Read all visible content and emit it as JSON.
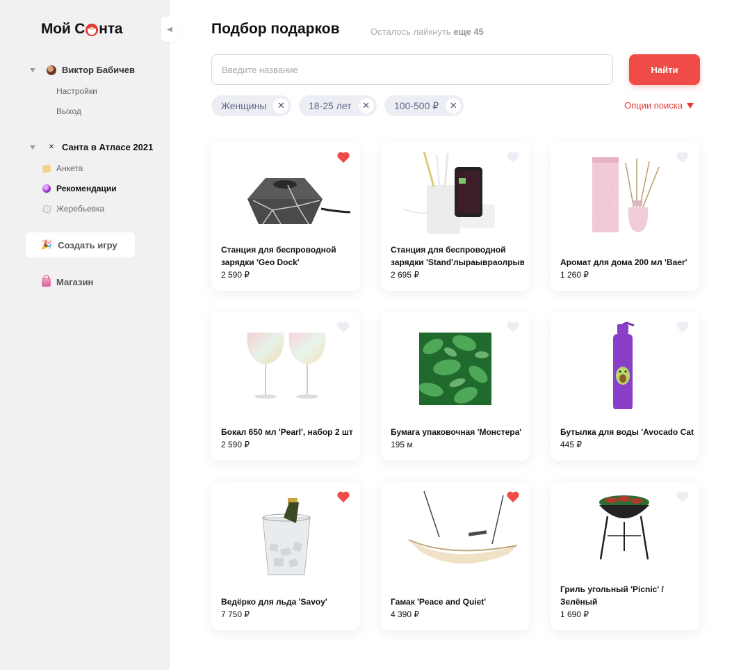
{
  "app": {
    "logo_before": "Мой С",
    "logo_after": "нта"
  },
  "sidebar": {
    "user": {
      "name": "Виктор Бабичев",
      "links": [
        "Настройки",
        "Выход"
      ]
    },
    "game": {
      "name": "Санта в Атласе 2021",
      "icon_text": "✕",
      "items": [
        {
          "label": "Анкета",
          "icon": "notepad-icon",
          "active": false
        },
        {
          "label": "Рекомендации",
          "icon": "crystal-ball-icon",
          "active": true
        },
        {
          "label": "Жеребьевка",
          "icon": "dice-icon",
          "active": false
        }
      ]
    },
    "create_game": "Создать игру",
    "shop": "Магазин"
  },
  "main": {
    "title": "Подбор подарков",
    "likes_left_prefix": "Осталось лайкнуть",
    "likes_left_value": "еще 45",
    "search": {
      "placeholder": "Введите название",
      "value": ""
    },
    "find_label": "Найти",
    "filters": [
      "Женщины",
      "18-25 лет",
      "100-500 ₽"
    ],
    "options_label": "Опции поиска"
  },
  "colors": {
    "accent": "#ef4b47",
    "heart_liked": "#ef4b47",
    "heart_empty": "#eceef4",
    "chip_bg": "#eceef4",
    "sidebar_bg": "#f1f1f2"
  },
  "products": [
    {
      "title_lines": [
        "Станция для беспроводной",
        "зарядки 'Geo Dock'"
      ],
      "price": "2 590 ₽",
      "liked": true
    },
    {
      "title_lines": [
        "Станция для беспроводной",
        "зарядки 'Stand'лыраывраолрыв"
      ],
      "price": "2 695 ₽",
      "liked": false
    },
    {
      "title_lines": [
        "Аромат для дома 200 мл 'Baer'"
      ],
      "price": "1 260 ₽",
      "liked": false
    },
    {
      "title_lines": [
        "Бокал 650 мл 'Pearl', набор 2 шт"
      ],
      "price": "2 590 ₽",
      "liked": false
    },
    {
      "title_lines": [
        "Бумага упаковочная 'Монстера'"
      ],
      "price": "195 м",
      "liked": false
    },
    {
      "title_lines": [
        "Бутылка для воды 'Avocado Cat'"
      ],
      "price": "445 ₽",
      "liked": false
    },
    {
      "title_lines": [
        "Ведёрко для льда 'Savoy'"
      ],
      "price": "7 750 ₽",
      "liked": true
    },
    {
      "title_lines": [
        "Гамак 'Peace and Quiet'"
      ],
      "price": "4 390 ₽",
      "liked": true
    },
    {
      "title_lines": [
        "Гриль угольный 'Picnic' /",
        "Зелёный"
      ],
      "price": "1 690 ₽",
      "liked": false
    }
  ]
}
